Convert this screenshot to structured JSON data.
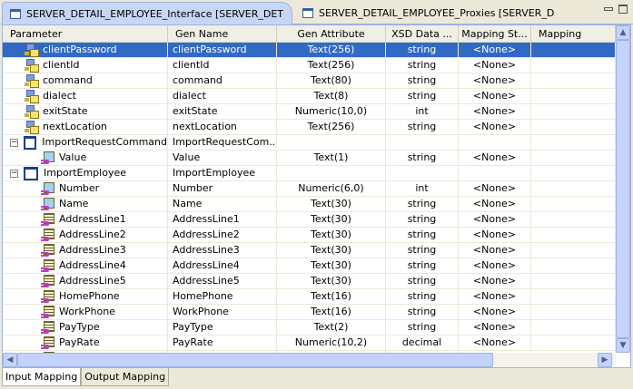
{
  "tabs": [
    {
      "label": "SERVER_DETAIL_EMPLOYEE_Interface [SERVER_DET",
      "active": true
    },
    {
      "label": "SERVER_DETAIL_EMPLOYEE_Proxies [SERVER_DETAIL",
      "active": false
    }
  ],
  "columns": [
    "Parameter",
    "Gen Name",
    "Gen Attribute",
    "XSD Data ...",
    "Mapping St...",
    "Mapping"
  ],
  "rows": [
    {
      "icon": "view",
      "indent": 1,
      "param": "clientPassword",
      "gen": "clientPassword",
      "attr": "Text(256)",
      "xsd": "string",
      "map": "<None>",
      "mapping": "",
      "selected": true
    },
    {
      "icon": "view",
      "indent": 1,
      "param": "clientId",
      "gen": "clientId",
      "attr": "Text(256)",
      "xsd": "string",
      "map": "<None>",
      "mapping": ""
    },
    {
      "icon": "view",
      "indent": 1,
      "param": "command",
      "gen": "command",
      "attr": "Text(80)",
      "xsd": "string",
      "map": "<None>",
      "mapping": ""
    },
    {
      "icon": "view",
      "indent": 1,
      "param": "dialect",
      "gen": "dialect",
      "attr": "Text(8)",
      "xsd": "string",
      "map": "<None>",
      "mapping": ""
    },
    {
      "icon": "view",
      "indent": 1,
      "param": "exitState",
      "gen": "exitState",
      "attr": "Numeric(10,0)",
      "xsd": "int",
      "map": "<None>",
      "mapping": ""
    },
    {
      "icon": "view",
      "indent": 1,
      "param": "nextLocation",
      "gen": "nextLocation",
      "attr": "Text(256)",
      "xsd": "string",
      "map": "<None>",
      "mapping": ""
    },
    {
      "icon": "group",
      "indent": 0,
      "param": "ImportRequestCommand",
      "gen": "ImportRequestCom...",
      "attr": "",
      "xsd": "",
      "map": "",
      "mapping": ""
    },
    {
      "icon": "attr-check",
      "indent": 2,
      "param": "Value",
      "gen": "Value",
      "attr": "Text(1)",
      "xsd": "string",
      "map": "<None>",
      "mapping": ""
    },
    {
      "icon": "group",
      "indent": 0,
      "param": "ImportEmployee",
      "gen": "ImportEmployee",
      "attr": "",
      "xsd": "",
      "map": "",
      "mapping": ""
    },
    {
      "icon": "attr-check",
      "indent": 2,
      "param": "Number",
      "gen": "Number",
      "attr": "Numeric(6,0)",
      "xsd": "int",
      "map": "<None>",
      "mapping": ""
    },
    {
      "icon": "attr-check",
      "indent": 2,
      "param": "Name",
      "gen": "Name",
      "attr": "Text(30)",
      "xsd": "string",
      "map": "<None>",
      "mapping": ""
    },
    {
      "icon": "attr",
      "indent": 2,
      "param": "AddressLine1",
      "gen": "AddressLine1",
      "attr": "Text(30)",
      "xsd": "string",
      "map": "<None>",
      "mapping": ""
    },
    {
      "icon": "attr",
      "indent": 2,
      "param": "AddressLine2",
      "gen": "AddressLine2",
      "attr": "Text(30)",
      "xsd": "string",
      "map": "<None>",
      "mapping": ""
    },
    {
      "icon": "attr",
      "indent": 2,
      "param": "AddressLine3",
      "gen": "AddressLine3",
      "attr": "Text(30)",
      "xsd": "string",
      "map": "<None>",
      "mapping": ""
    },
    {
      "icon": "attr",
      "indent": 2,
      "param": "AddressLine4",
      "gen": "AddressLine4",
      "attr": "Text(30)",
      "xsd": "string",
      "map": "<None>",
      "mapping": ""
    },
    {
      "icon": "attr",
      "indent": 2,
      "param": "AddressLine5",
      "gen": "AddressLine5",
      "attr": "Text(30)",
      "xsd": "string",
      "map": "<None>",
      "mapping": ""
    },
    {
      "icon": "attr",
      "indent": 2,
      "param": "HomePhone",
      "gen": "HomePhone",
      "attr": "Text(16)",
      "xsd": "string",
      "map": "<None>",
      "mapping": ""
    },
    {
      "icon": "attr",
      "indent": 2,
      "param": "WorkPhone",
      "gen": "WorkPhone",
      "attr": "Text(16)",
      "xsd": "string",
      "map": "<None>",
      "mapping": ""
    },
    {
      "icon": "attr",
      "indent": 2,
      "param": "PayType",
      "gen": "PayType",
      "attr": "Text(2)",
      "xsd": "string",
      "map": "<None>",
      "mapping": ""
    },
    {
      "icon": "attr",
      "indent": 2,
      "param": "PayRate",
      "gen": "PayRate",
      "attr": "Numeric(10,2)",
      "xsd": "decimal",
      "map": "<None>",
      "mapping": ""
    },
    {
      "icon": "attr",
      "indent": 2,
      "param": "",
      "gen": "",
      "attr": "",
      "xsd": "",
      "map": "",
      "mapping": ""
    }
  ],
  "bottom_tabs": [
    {
      "label": "Input Mapping",
      "active": true
    },
    {
      "label": "Output Mapping",
      "active": false
    }
  ],
  "colors": {
    "selection": "#316ac5",
    "scroll": "#c3d3fd"
  }
}
